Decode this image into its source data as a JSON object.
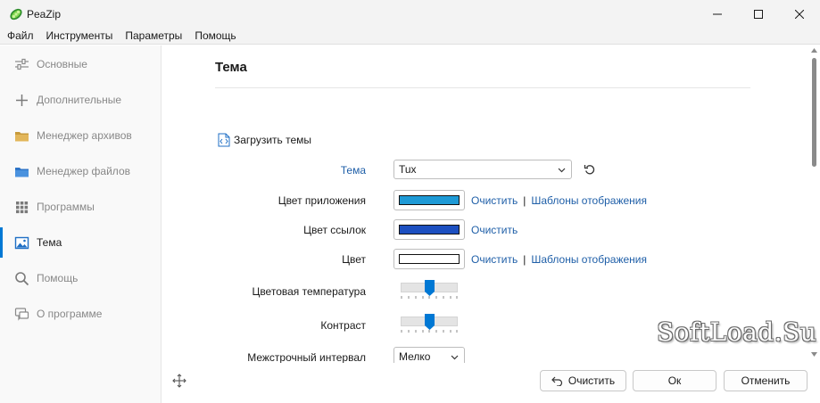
{
  "window": {
    "title": "PeaZip",
    "minimize_icon": "minimize-icon",
    "maximize_icon": "maximize-icon",
    "close_icon": "close-icon"
  },
  "menu": [
    "Файл",
    "Инструменты",
    "Параметры",
    "Помощь"
  ],
  "sidebar": {
    "items": [
      {
        "label": "Основные",
        "icon": "sliders-icon"
      },
      {
        "label": "Дополнительные",
        "icon": "plus-icon"
      },
      {
        "label": "Менеджер архивов",
        "icon": "archive-folder-icon"
      },
      {
        "label": "Менеджер файлов",
        "icon": "folder-icon"
      },
      {
        "label": "Программы",
        "icon": "apps-grid-icon"
      },
      {
        "label": "Тема",
        "icon": "image-icon",
        "active": true
      },
      {
        "label": "Помощь",
        "icon": "search-icon"
      },
      {
        "label": "О программе",
        "icon": "chat-icon"
      }
    ]
  },
  "main": {
    "title": "Тема",
    "load_themes": "Загрузить темы",
    "theme": {
      "label": "Тема",
      "value": "Tux"
    },
    "app_color": {
      "label": "Цвет приложения",
      "swatch": "#1e9ad6",
      "clear": "Очистить",
      "templates": "Шаблоны отображения"
    },
    "link_color": {
      "label": "Цвет ссылок",
      "swatch": "#1c4fc0",
      "clear": "Очистить"
    },
    "color": {
      "label": "Цвет",
      "swatch": "#ffffff",
      "clear": "Очистить",
      "templates": "Шаблоны отображения"
    },
    "separator": "|",
    "color_temperature": {
      "label": "Цветовая температура",
      "level": 0.5
    },
    "contrast": {
      "label": "Контраст",
      "level": 0.5
    },
    "line_spacing": {
      "label": "Межстрочный интервал",
      "value": "Мелко"
    }
  },
  "footer": {
    "clear": "Очистить",
    "ok": "Ок",
    "cancel": "Отменить"
  },
  "watermark": "SoftLoad.Su",
  "colors": {
    "accent": "#0078d4",
    "link": "#1f5fa8"
  }
}
